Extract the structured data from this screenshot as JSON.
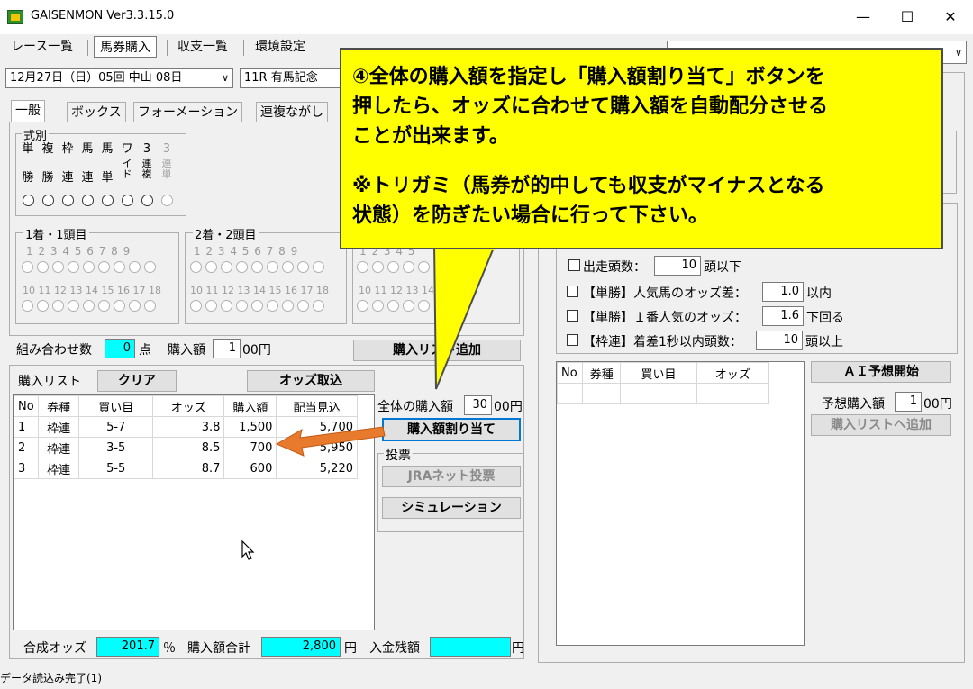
{
  "window": {
    "title": "GAISENMON Ver3.3.15.0",
    "minimize": "—",
    "maximize": "☐",
    "close": "✕"
  },
  "menu": [
    "レース一覧",
    "馬券購入",
    "収支一覧",
    "環境設定"
  ],
  "race_selector": {
    "date_value": "12月27日（日）05回 中山 08日",
    "race_value": "11R 有馬記念"
  },
  "tabs": [
    "一般",
    "ボックス",
    "フォーメーション",
    "連複ながし"
  ],
  "bet_types": {
    "label": "式別",
    "items": [
      {
        "top": "単",
        "bottom": "勝"
      },
      {
        "top": "複",
        "bottom": "勝"
      },
      {
        "top": "枠",
        "bottom": "連"
      },
      {
        "top": "馬",
        "bottom": "連"
      },
      {
        "top": "馬",
        "bottom": "単"
      },
      {
        "top": "ワ",
        "bottom": "イド"
      },
      {
        "top": "3",
        "bottom": "連複"
      },
      {
        "top": "3",
        "bottom": "連単"
      }
    ]
  },
  "horse_groups": [
    {
      "label": "1着・1頭目",
      "row1": "1 2 3 4 5 6 7 8 9",
      "row2": "10 11 12 13 14 15 16 17 18"
    },
    {
      "label": "2着・2頭目",
      "row1": "1 2 3 4 5 6 7 8 9",
      "row2": "10 11 12 13 14 15 16 17 18"
    },
    {
      "label": "",
      "row1": "1 2 3 4 5",
      "row2": "10 11 12 13 14"
    }
  ],
  "combo_row": {
    "count_label": "組み合わせ数",
    "count_value": "0",
    "count_unit": "点",
    "amount_label": "購入額",
    "amount_value": "1",
    "amount_unit": "00円",
    "add_button": "購入リスト追加"
  },
  "purchase_list": {
    "title": "購入リスト",
    "clear_button": "クリア",
    "odds_button": "オッズ取込",
    "headers": [
      "No",
      "券種",
      "買い目",
      "オッズ",
      "購入額",
      "配当見込"
    ],
    "rows": [
      [
        "1",
        "枠連",
        "5-7",
        "3.8",
        "1,500",
        "5,700"
      ],
      [
        "2",
        "枠連",
        "3-5",
        "8.5",
        "700",
        "5,950"
      ],
      [
        "3",
        "枠連",
        "5-5",
        "8.7",
        "600",
        "5,220"
      ]
    ]
  },
  "allocation": {
    "total_label": "全体の購入額",
    "total_value": "30",
    "total_unit": "00円",
    "allocate_button": "購入額割り当て",
    "vote_label": "投票",
    "jra_button": "JRAネット投票",
    "simulation_button": "シミュレーション"
  },
  "summary": {
    "odds_label": "合成オッズ",
    "odds_value": "201.7",
    "odds_unit": "％",
    "total_label": "購入額合計",
    "total_value": "2,800",
    "total_unit": "円",
    "balance_label": "入金残額",
    "balance_value": "",
    "balance_unit": "円"
  },
  "ai_panel": {
    "conditions": [
      {
        "label": "出走頭数：",
        "value": "10",
        "suffix": "頭以下"
      },
      {
        "label": "【単勝】人気馬のオッズ差：",
        "value": "1.0",
        "suffix": "以内"
      },
      {
        "label": "【単勝】１番人気のオッズ：",
        "value": "1.6",
        "suffix": "下回る"
      },
      {
        "label": "【枠連】着差1秒以内頭数：",
        "value": "10",
        "suffix": "頭以上"
      }
    ],
    "headers": [
      "No",
      "券種",
      "買い目",
      "オッズ"
    ],
    "start_button": "ＡＩ予想開始",
    "amount_label": "予想購入額",
    "amount_value": "1",
    "amount_unit": "00円",
    "add_button": "購入リストへ追加"
  },
  "callout": {
    "line1": "④全体の購入額を指定し「購入額割り当て」ボタンを",
    "line2": "押したら、オッズに合わせて購入額を自動配分させる",
    "line3": "ことが出来ます。",
    "line4": "※トリガミ（馬券が的中しても収支がマイナスとなる",
    "line5": "状態）を防ぎたい場合に行って下さい。"
  },
  "status": "データ読込み完了(1)",
  "colors": {
    "callout_bg": "#ffff00",
    "arrow": "#e87a2e",
    "highlight_field": "#00ffff",
    "focus_border": "#0078d7"
  }
}
